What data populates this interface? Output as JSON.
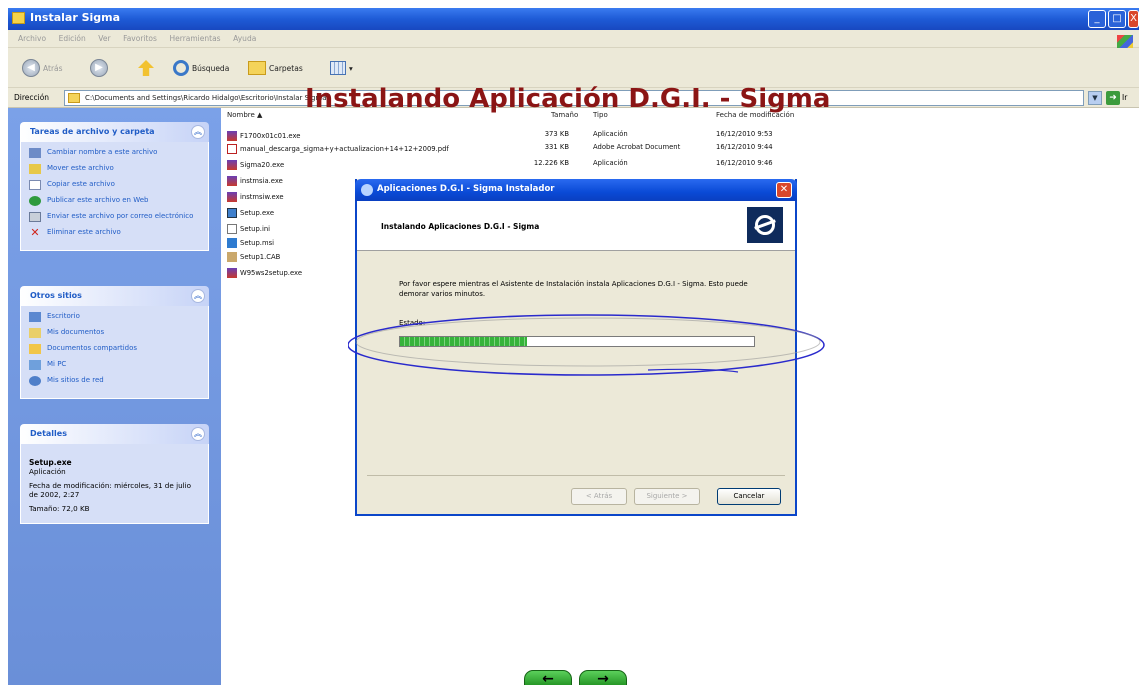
{
  "window": {
    "title": "Instalar Sigma",
    "controls": {
      "minimize": "_",
      "maximize": "□",
      "close": "X"
    }
  },
  "menu": [
    "Archivo",
    "Edición",
    "Ver",
    "Favoritos",
    "Herramientas",
    "Ayuda"
  ],
  "toolbar": {
    "back_label": "Atrás",
    "search_label": "Búsqueda",
    "folders_label": "Carpetas"
  },
  "address": {
    "label": "Dirección",
    "path": "C:\\Documents and Settings\\Ricardo Hidalgo\\Escritorio\\Instalar Sigma",
    "go_label": "Ir"
  },
  "caption": "Instalando Aplicación D.G.I. - Sigma",
  "sidebar": {
    "tasks": {
      "header": "Tareas de archivo y carpeta",
      "items": [
        {
          "label": "Cambiar nombre a este archivo",
          "icon": "rename-icon"
        },
        {
          "label": "Mover este archivo",
          "icon": "move-icon"
        },
        {
          "label": "Copiar este archivo",
          "icon": "copy-icon"
        },
        {
          "label": "Publicar este archivo en Web",
          "icon": "web-icon"
        },
        {
          "label": "Enviar este archivo por correo electrónico",
          "icon": "mail-icon"
        },
        {
          "label": "Eliminar este archivo",
          "icon": "delete-icon"
        }
      ]
    },
    "places": {
      "header": "Otros sitios",
      "items": [
        {
          "label": "Escritorio",
          "icon": "desktop-icon"
        },
        {
          "label": "Mis documentos",
          "icon": "documents-icon"
        },
        {
          "label": "Documentos compartidos",
          "icon": "shared-documents-icon"
        },
        {
          "label": "Mi PC",
          "icon": "computer-icon"
        },
        {
          "label": "Mis sitios de red",
          "icon": "network-icon"
        }
      ]
    },
    "details": {
      "header": "Detalles",
      "name": "Setup.exe",
      "type": "Aplicación",
      "modified": "Fecha de modificación: miércoles, 31 de julio de 2002, 2:27",
      "size": "Tamaño: 72,0 KB"
    }
  },
  "filelist": {
    "columns": {
      "name": "Nombre",
      "size": "Tamaño",
      "type": "Tipo",
      "date": "Fecha de modificación"
    },
    "files": [
      {
        "name": "F1700x01c01.exe",
        "size": "373 KB",
        "type": "Aplicación",
        "date": "16/12/2010 9:53",
        "icon": "exe"
      },
      {
        "name": "manual_descarga_sigma+y+actualizacion+14+12+2009.pdf",
        "size": "331 KB",
        "type": "Adobe Acrobat Document",
        "date": "16/12/2010 9:44",
        "icon": "pdf"
      },
      {
        "name": "Sigma20.exe",
        "size": "12.226 KB",
        "type": "Aplicación",
        "date": "16/12/2010 9:46",
        "icon": "exe"
      },
      {
        "name": "instmsia.exe",
        "icon": "exe"
      },
      {
        "name": "instmsiw.exe",
        "icon": "exe"
      },
      {
        "name": "Setup.exe",
        "icon": "setup"
      },
      {
        "name": "Setup.ini",
        "icon": "ini"
      },
      {
        "name": "Setup.msi",
        "icon": "msi"
      },
      {
        "name": "Setup1.CAB",
        "icon": "cab"
      },
      {
        "name": "W95ws2setup.exe",
        "icon": "exe"
      }
    ]
  },
  "dialog": {
    "title": "Aplicaciones D.G.I - Sigma Instalador",
    "banner_text": "Instalando Aplicaciones D.G.I - Sigma",
    "message": "Por favor espere mientras el Asistente de Instalación instala Aplicaciones D.G.I - Sigma. Esto puede demorar varios minutos.",
    "status_label": "Estado:",
    "progress": 0.36,
    "buttons": {
      "back": "< Atrás",
      "next": "Siguiente >",
      "cancel": "Cancelar"
    }
  },
  "colors": {
    "caption": "#8b1515",
    "annotation": "#2a2acc",
    "progress": "#36b33a"
  },
  "nav": {
    "prev": "←",
    "next": "→"
  }
}
